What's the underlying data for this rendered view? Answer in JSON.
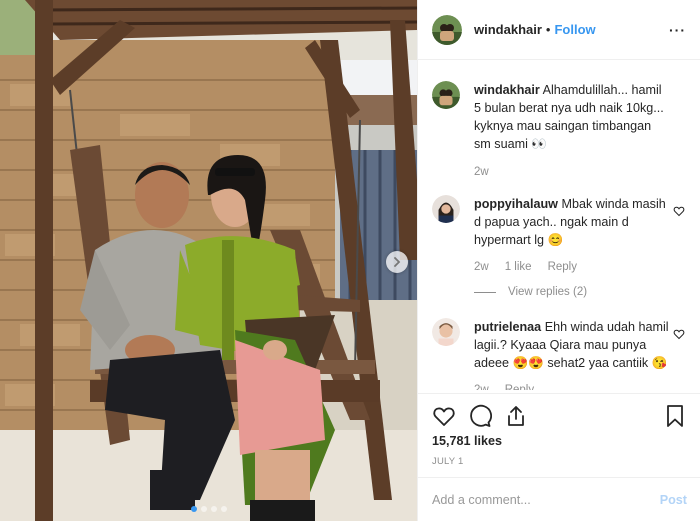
{
  "post": {
    "username": "windakhair",
    "separator": "•",
    "follow_label": "Follow",
    "more_label": "···",
    "photo_dots": 4,
    "photo_active_dot": 0
  },
  "comments": [
    {
      "username": "windakhair",
      "text": "Alhamdulillah... hamil 5 bulan berat nya udh naik 10kg... kyknya mau saingan timbangan sm suami 👀",
      "age": "2w"
    },
    {
      "username": "poppyihalauw",
      "text": "Mbak winda masih d papua yach.. ngak main d hypermart lg 😊",
      "age": "2w",
      "likes": "1 like",
      "reply_label": "Reply",
      "view_replies": "View replies (2)"
    },
    {
      "username": "putrielenaa",
      "text": "Ehh winda udah hamil lagii.? Kyaaa Qiara mau punya adeee 😍😍 sehat2 yaa cantiik 😘",
      "age": "2w",
      "reply_label": "Reply"
    }
  ],
  "engagement": {
    "likes": "15,781 likes",
    "date": "JULY 1"
  },
  "add_comment": {
    "placeholder": "Add a comment...",
    "post_label": "Post"
  },
  "icons": {
    "like": "heart-icon",
    "comment": "comment-bubble-icon",
    "share": "share-icon",
    "save": "bookmark-icon",
    "next": "chevron-right-icon",
    "more": "more-options-icon"
  },
  "colors": {
    "link_blue": "#3897f0",
    "post_disabled": "#b3d4f7",
    "muted": "#8e8e8e",
    "text": "#262626"
  }
}
